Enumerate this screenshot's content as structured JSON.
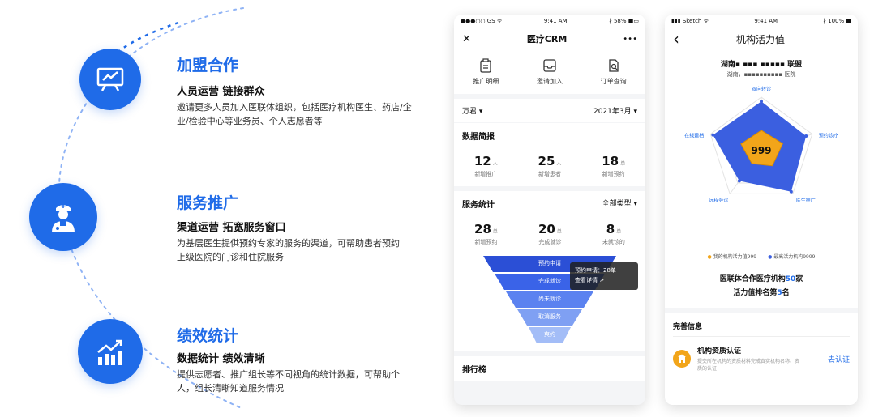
{
  "features": [
    {
      "title": "加盟合作",
      "subtitle": "人员运营 链接群众",
      "desc": "邀请更多人员加入医联体组织，包括医疗机构医生、药店/企业/检验中心等业务员、个人志愿者等",
      "icon": "chart-board-icon"
    },
    {
      "title": "服务推广",
      "subtitle": "渠道运营 拓宽服务窗口",
      "desc": "为基层医生提供预约专家的服务的渠道，可帮助患者预约上级医院的门诊和住院服务",
      "icon": "doctor-icon"
    },
    {
      "title": "绩效统计",
      "subtitle": "数据统计 绩效清晰",
      "desc": "提供志愿者、推广组长等不同视角的统计数据，可帮助个人，组长清晰知道服务情况",
      "icon": "growth-chart-icon"
    }
  ],
  "phone1": {
    "status": {
      "left": "●●●○○ GS ᯤ",
      "time": "9:41 AM",
      "right": "∦ 58% ■▭"
    },
    "title": "医疗CRM",
    "close": "✕",
    "more": "•••",
    "quick": [
      "推广明细",
      "邀请加入",
      "订单查询"
    ],
    "filter_left": "万君 ▾",
    "filter_right": "2021年3月 ▾",
    "brief_title": "数据简报",
    "brief": [
      {
        "num": "12",
        "unit": "人",
        "label": "新增推广"
      },
      {
        "num": "25",
        "unit": "人",
        "label": "新增患者"
      },
      {
        "num": "18",
        "unit": "单",
        "label": "新增预约"
      }
    ],
    "service_title": "服务统计",
    "service_filter": "全部类型 ▾",
    "service": [
      {
        "num": "28",
        "unit": "单",
        "label": "新增预约"
      },
      {
        "num": "20",
        "unit": "单",
        "label": "完成就诊"
      },
      {
        "num": "8",
        "unit": "单",
        "label": "未就诊的"
      }
    ],
    "funnel": [
      "预约申请",
      "完成就诊",
      "尚未就诊",
      "取消服务",
      "爽约"
    ],
    "tooltip_line1": "预约申请：28单",
    "tooltip_line2": "查看详情 >",
    "bottom": "排行榜"
  },
  "phone2": {
    "status": {
      "left": "▮▮▮ Sketch ᯤ",
      "time": "9:41 AM",
      "right": "∦ 100% ■"
    },
    "back": "‹",
    "title": "机构活力值",
    "org_name": "湖南▪ ▪▪▪ ▪▪▪▪▪ 联盟",
    "org_sub": "湖南，▪▪▪▪▪▪▪▪▪▪ 医院",
    "radar_labels": [
      "双向转诊",
      "预约诊疗",
      "医生推广",
      "远程会诊",
      "在线建档"
    ],
    "radar_value": "999",
    "radar_mine": [
      0.38,
      0.42,
      0.35,
      0.3,
      0.4
    ],
    "radar_max": [
      0.92,
      0.88,
      0.95,
      0.7,
      0.95
    ],
    "legend_mine": "我的机构活力值999",
    "legend_max": "最高活力机构9999",
    "colors": {
      "mine": "#f2a51a",
      "max": "#3b5fe0",
      "accent": "#1f6be8"
    },
    "summary_line1_pre": "医联体合作医疗机构",
    "summary_line1_num": "50",
    "summary_line1_post": "家",
    "summary_line2_pre": "活力值排名第",
    "summary_line2_num": "5",
    "summary_line2_post": "名",
    "complete_title": "完善信息",
    "cert_title": "机构资质认证",
    "cert_desc": "提交所在机构的资质材料完成真实机构名称、资质的认证",
    "cert_action": "去认证"
  }
}
